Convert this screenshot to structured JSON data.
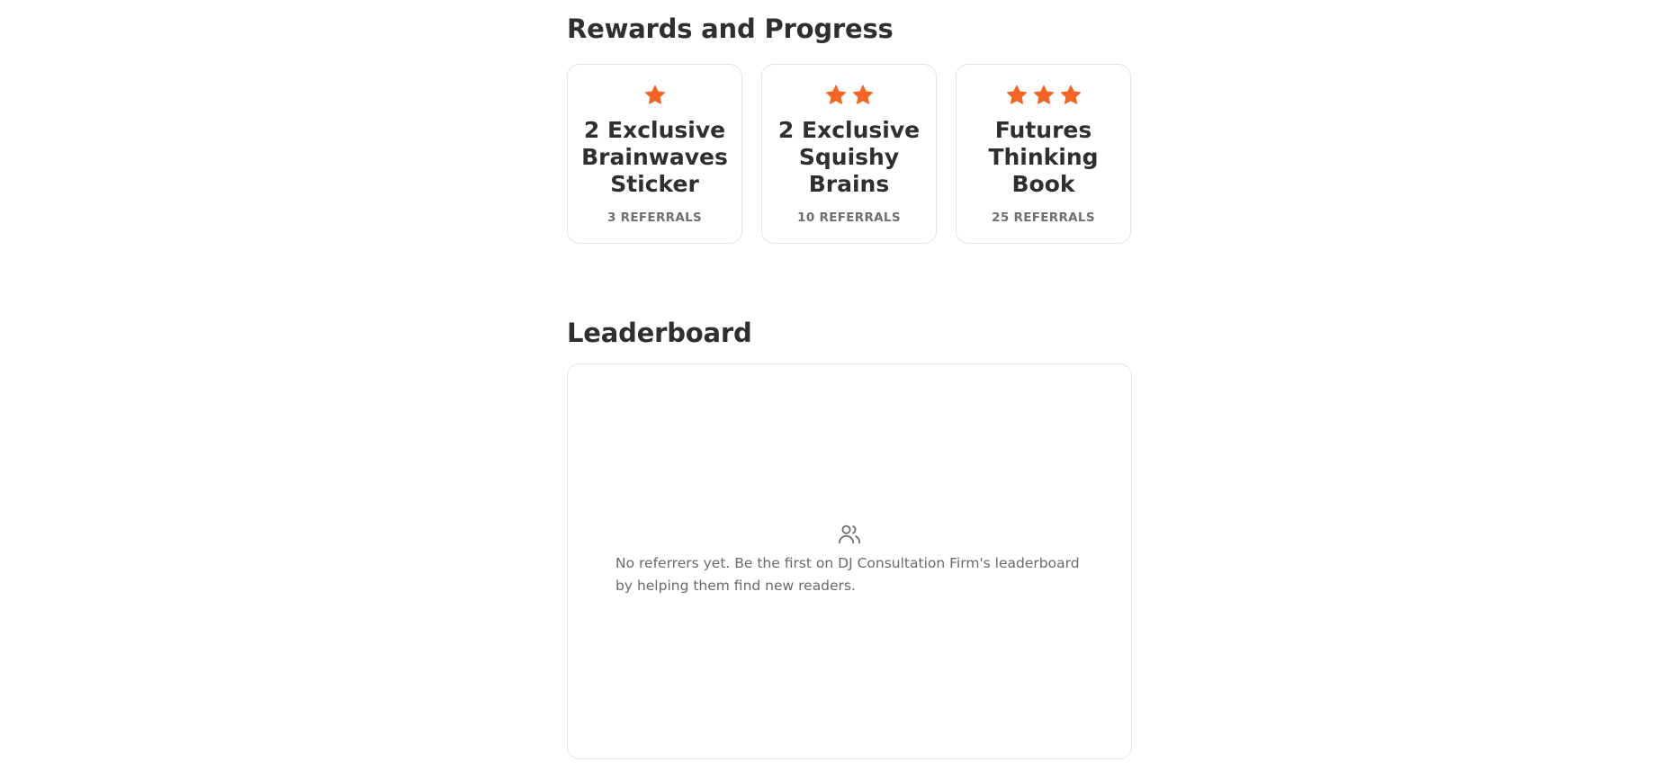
{
  "colors": {
    "accent": "#F26522",
    "text": "#2F2F2F",
    "muted": "#6F6F6F",
    "border": "#E4E4E4"
  },
  "rewards": {
    "title": "Rewards and Progress",
    "items": [
      {
        "name": "2 Exclusive Brainwaves Sticker",
        "requirement": "3 REFERRALS",
        "stars": 1,
        "icon": "star-icon"
      },
      {
        "name": "2 Exclusive Squishy Brains",
        "requirement": "10 REFERRALS",
        "stars": 2,
        "icon": "star-icon"
      },
      {
        "name": "Futures Thinking Book",
        "requirement": "25 REFERRALS",
        "stars": 3,
        "icon": "star-icon"
      }
    ]
  },
  "leaderboard": {
    "title": "Leaderboard",
    "empty_icon": "users-icon",
    "empty_message": "No referrers yet. Be the first on DJ Consultation Firm's leaderboard by helping them find new readers."
  }
}
